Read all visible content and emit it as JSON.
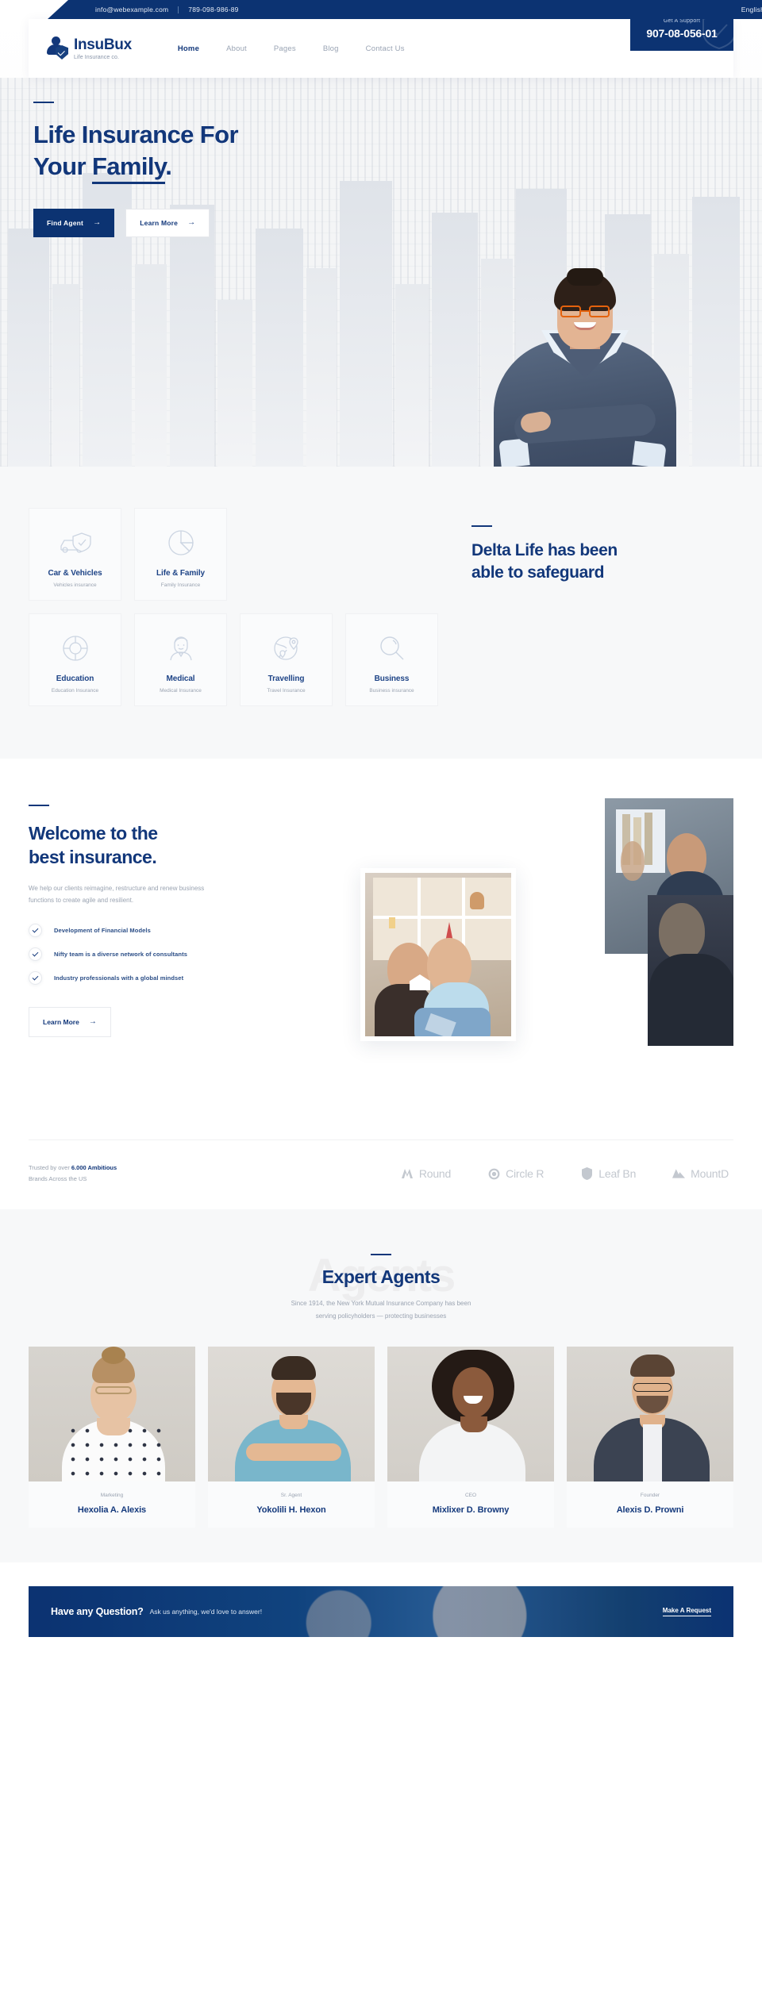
{
  "topbar": {
    "email": "info@webexample.com",
    "phone": "789-098-986-89",
    "language": "English"
  },
  "header": {
    "brand_name": "InsuBux",
    "brand_tagline": "Life Insurance co.",
    "nav": [
      {
        "label": "Home",
        "active": true
      },
      {
        "label": "About",
        "active": false
      },
      {
        "label": "Pages",
        "active": false
      },
      {
        "label": "Blog",
        "active": false
      },
      {
        "label": "Contact Us",
        "active": false
      }
    ],
    "support_label": "Get A Support",
    "support_phone": "907-08-056-01"
  },
  "hero": {
    "title_line1": "Life Insurance For",
    "title_line2_pre": "Your ",
    "title_line2_underline": "Family",
    "title_period": ".",
    "primary_button": "Find Agent",
    "secondary_button": "Learn More",
    "arrow": "→"
  },
  "services": {
    "heading_line1": "Delta Life has been",
    "heading_line2": "able to safeguard",
    "cards": [
      {
        "icon": "car-shield-icon",
        "title": "Car & Vehicles",
        "subtitle": "Vehicles insurance"
      },
      {
        "icon": "pie-chart-icon",
        "title": "Life & Family",
        "subtitle": "Family Insurance"
      },
      {
        "icon": "life-ring-icon",
        "title": "Education",
        "subtitle": "Education Insurance"
      },
      {
        "icon": "doctor-icon",
        "title": "Medical",
        "subtitle": "Medical Insurance"
      },
      {
        "icon": "globe-pin-icon",
        "title": "Travelling",
        "subtitle": "Travel Insurance"
      },
      {
        "icon": "magnifier-icon",
        "title": "Business",
        "subtitle": "Business insurance"
      }
    ]
  },
  "welcome": {
    "heading_line1": "Welcome to the",
    "heading_line2": "best insurance.",
    "paragraph": "We help our clients reimagine, restructure and renew business functions to create agile and resilient.",
    "features": [
      "Development of Financial Models",
      "Nifty team is a diverse network of consultants",
      "Industry professionals with a global mindset"
    ],
    "button": "Learn More",
    "arrow": "→"
  },
  "brands": {
    "trusted_pre": "Trusted by over ",
    "trusted_strong": "6.000 Ambitious",
    "trusted_post": "Brands Across the US",
    "logos": [
      {
        "icon": "double-m-icon",
        "label": "Round"
      },
      {
        "icon": "circle-ring-icon",
        "label": "Circle R"
      },
      {
        "icon": "leaf-shield-icon",
        "label": "Leaf Bn"
      },
      {
        "icon": "mountain-icon",
        "label": "MountD"
      }
    ]
  },
  "agents": {
    "ghost_word": "Agents",
    "title": "Expert Agents",
    "subtitle_line1": "Since 1914, the New York Mutual Insurance Company has been",
    "subtitle_line2": "serving policyholders — protecting businesses",
    "people": [
      {
        "role": "Marketing",
        "name": "Hexolia A. Alexis"
      },
      {
        "role": "Sr. Agent",
        "name": "Yokolili H. Hexon"
      },
      {
        "role": "CEO",
        "name": "Mixlixer D. Browny"
      },
      {
        "role": "Founder",
        "name": "Alexis D. Prowni"
      }
    ]
  },
  "cta": {
    "question": "Have any Question?",
    "text": "Ask us anything, we'd love to answer!",
    "link": "Make A Request"
  },
  "colors": {
    "brand_navy": "#0c3372",
    "heading_navy": "#12377a",
    "muted": "#9aa3b1",
    "page_bg": "#f7f8f9",
    "accent_orange": "#e4620d"
  }
}
